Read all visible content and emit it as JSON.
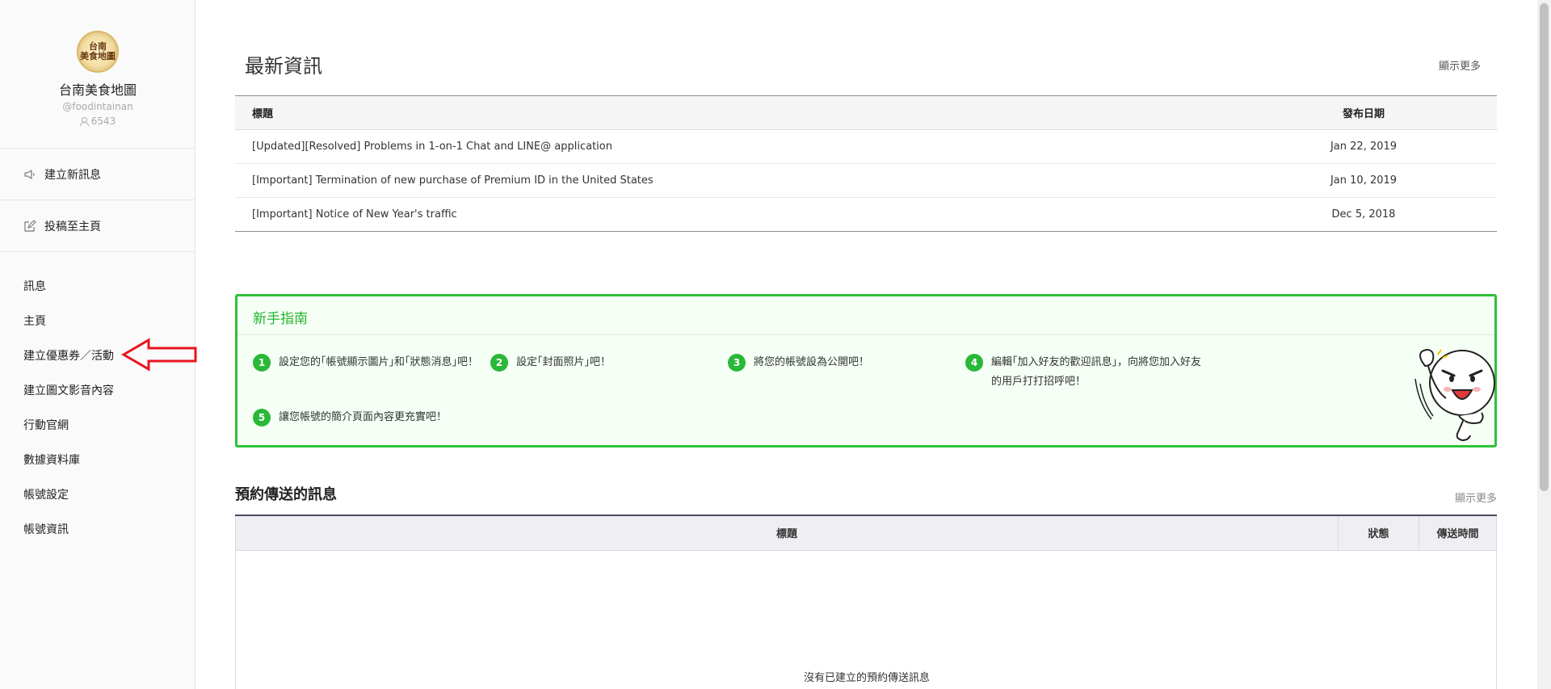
{
  "sidebar": {
    "avatar_text": [
      "台南",
      "美食地圖"
    ],
    "account_name": "台南美食地圖",
    "account_id": "@foodintainan",
    "follower_count": "6543",
    "actions": [
      {
        "label": "建立新訊息",
        "icon": "megaphone-icon"
      },
      {
        "label": "投稿至主頁",
        "icon": "edit-icon"
      }
    ],
    "nav": [
      {
        "label": "訊息"
      },
      {
        "label": "主頁"
      },
      {
        "label": "建立優惠券／活動"
      },
      {
        "label": "建立圖文影音內容"
      },
      {
        "label": "行動官網"
      },
      {
        "label": "數據資料庫"
      },
      {
        "label": "帳號設定"
      },
      {
        "label": "帳號資訊"
      }
    ],
    "annotation_arrow_color": "#e8141b"
  },
  "news": {
    "title": "最新資訊",
    "more": "顯示更多",
    "columns": {
      "title": "標題",
      "date": "發布日期"
    },
    "rows": [
      {
        "title": "[Updated][Resolved] Problems in 1-on-1 Chat and LINE@ application",
        "date": "Jan 22, 2019"
      },
      {
        "title": "[Important] Termination of new purchase of Premium ID in the United States",
        "date": "Jan 10, 2019"
      },
      {
        "title": "[Important] Notice of New Year's traffic",
        "date": "Dec 5, 2018"
      }
    ]
  },
  "guide": {
    "title": "新手指南",
    "accent": "#2ec139",
    "steps": [
      {
        "num": "1",
        "text": "設定您的｢帳號顯示圖片｣和｢狀態消息｣吧！"
      },
      {
        "num": "2",
        "text": "設定｢封面照片｣吧！"
      },
      {
        "num": "3",
        "text": "將您的帳號設為公開吧！"
      },
      {
        "num": "4",
        "line1": "編輯｢加入好友的歡迎訊息｣，向將您加入好友",
        "line2": "的用戶打打招呼吧！"
      },
      {
        "num": "5",
        "text": "讓您帳號的簡介頁面內容更充實吧！"
      }
    ]
  },
  "scheduled": {
    "title": "預約傳送的訊息",
    "more": "顯示更多",
    "columns": {
      "title": "標題",
      "status": "狀態",
      "time": "傳送時間"
    },
    "empty": "沒有已建立的預約傳送訊息"
  }
}
